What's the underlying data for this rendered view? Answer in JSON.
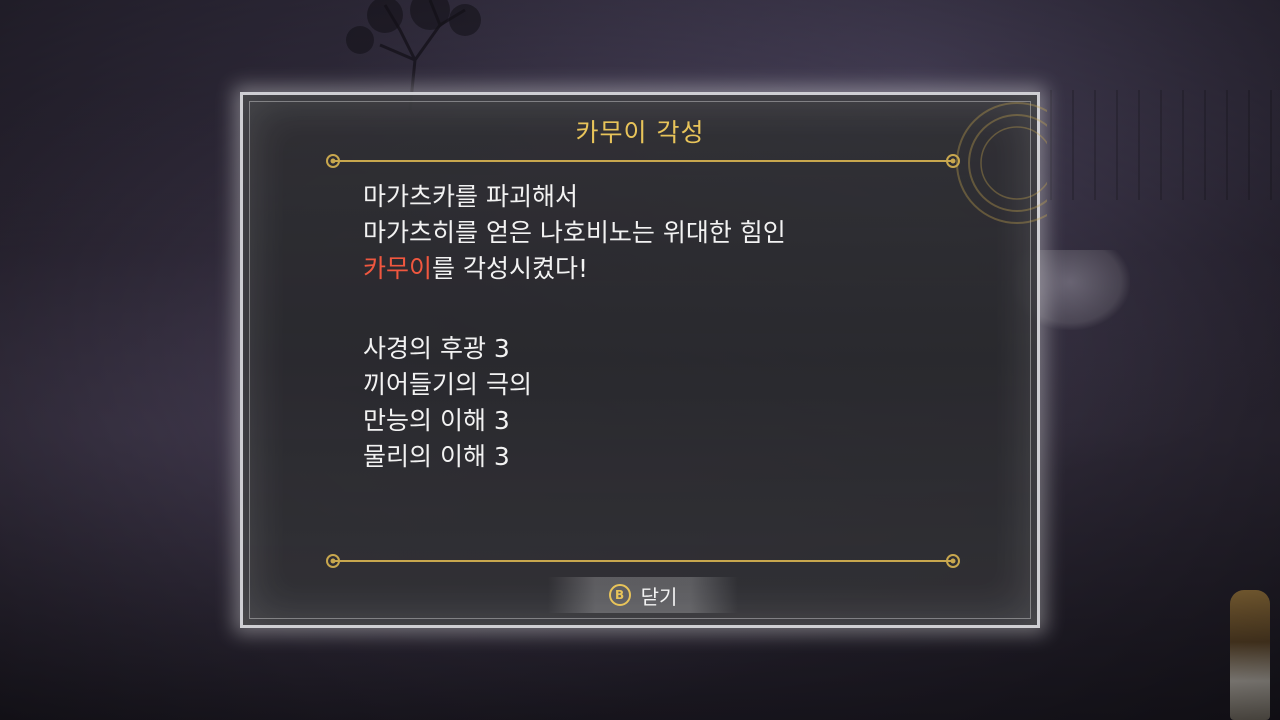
{
  "dialog": {
    "title": "카무이 각성",
    "lines": [
      {
        "text": "마가츠카를 파괴해서"
      },
      {
        "text": "마가츠히를 얻은 나호비노는 위대한 힘인"
      },
      {
        "highlight": "카무이",
        "text": "를 각성시켰다!"
      }
    ],
    "skills": [
      "사경의 후광 3",
      "끼어들기의 극의",
      "만능의 이해 3",
      "물리의 이해 3"
    ],
    "close": {
      "button_glyph": "B",
      "label": "닫기"
    }
  },
  "colors": {
    "title": "#e8c45a",
    "highlight": "#f0573f",
    "body_text": "#f2f2f2",
    "ornament_gold": "#c8a74e"
  }
}
